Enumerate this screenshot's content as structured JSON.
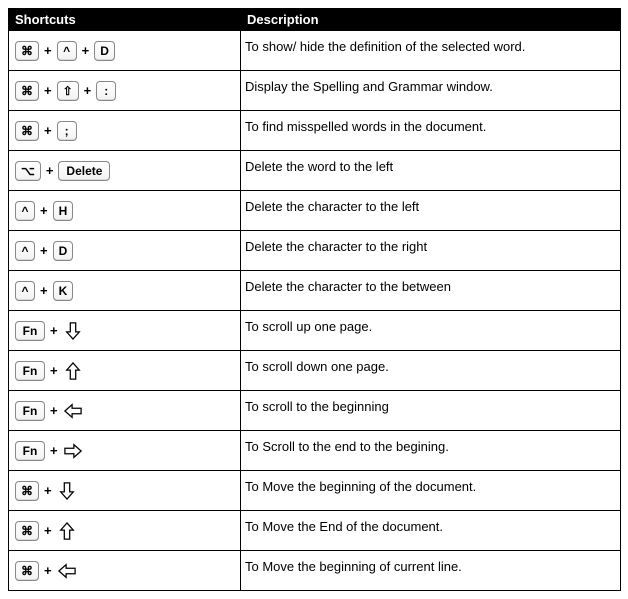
{
  "headers": {
    "shortcuts": "Shortcuts",
    "description": "Description"
  },
  "keys": {
    "cmd": "⌘",
    "ctrl": "^",
    "shift": "⇧",
    "opt": "⌥",
    "fn": "Fn",
    "D": "D",
    "H": "H",
    "K": "K",
    "colon": ":",
    "semicolon": ";",
    "delete": "Delete",
    "plus": "+"
  },
  "rows": [
    {
      "keys": [
        "cmd",
        "ctrl",
        "D"
      ],
      "desc": "To show/ hide the definition of the selected word."
    },
    {
      "keys": [
        "cmd",
        "shift",
        "colon"
      ],
      "desc": "Display the Spelling and Grammar window."
    },
    {
      "keys": [
        "cmd",
        "semicolon"
      ],
      "desc": "To find misspelled words in the document."
    },
    {
      "keys": [
        "opt",
        "delete"
      ],
      "desc": "Delete the word to the left"
    },
    {
      "keys": [
        "ctrl",
        "H"
      ],
      "desc": "Delete the character to the left"
    },
    {
      "keys": [
        "ctrl",
        "D"
      ],
      "desc": "Delete the character to the right"
    },
    {
      "keys": [
        "ctrl",
        "K"
      ],
      "desc": "Delete the character to the between"
    },
    {
      "keys": [
        "fn",
        "arrow-down"
      ],
      "desc": "To scroll up one page."
    },
    {
      "keys": [
        "fn",
        "arrow-up"
      ],
      "desc": "To scroll down one page."
    },
    {
      "keys": [
        "fn",
        "arrow-left"
      ],
      "desc": "To scroll to the beginning"
    },
    {
      "keys": [
        "fn",
        "arrow-right"
      ],
      "desc": "To Scroll to the end to the begining."
    },
    {
      "keys": [
        "cmd",
        "arrow-down"
      ],
      "desc": "To Move the beginning of the document."
    },
    {
      "keys": [
        "cmd",
        "arrow-up"
      ],
      "desc": "To Move the End of the document."
    },
    {
      "keys": [
        "cmd",
        "arrow-left"
      ],
      "desc": "To Move the beginning of current line."
    }
  ]
}
